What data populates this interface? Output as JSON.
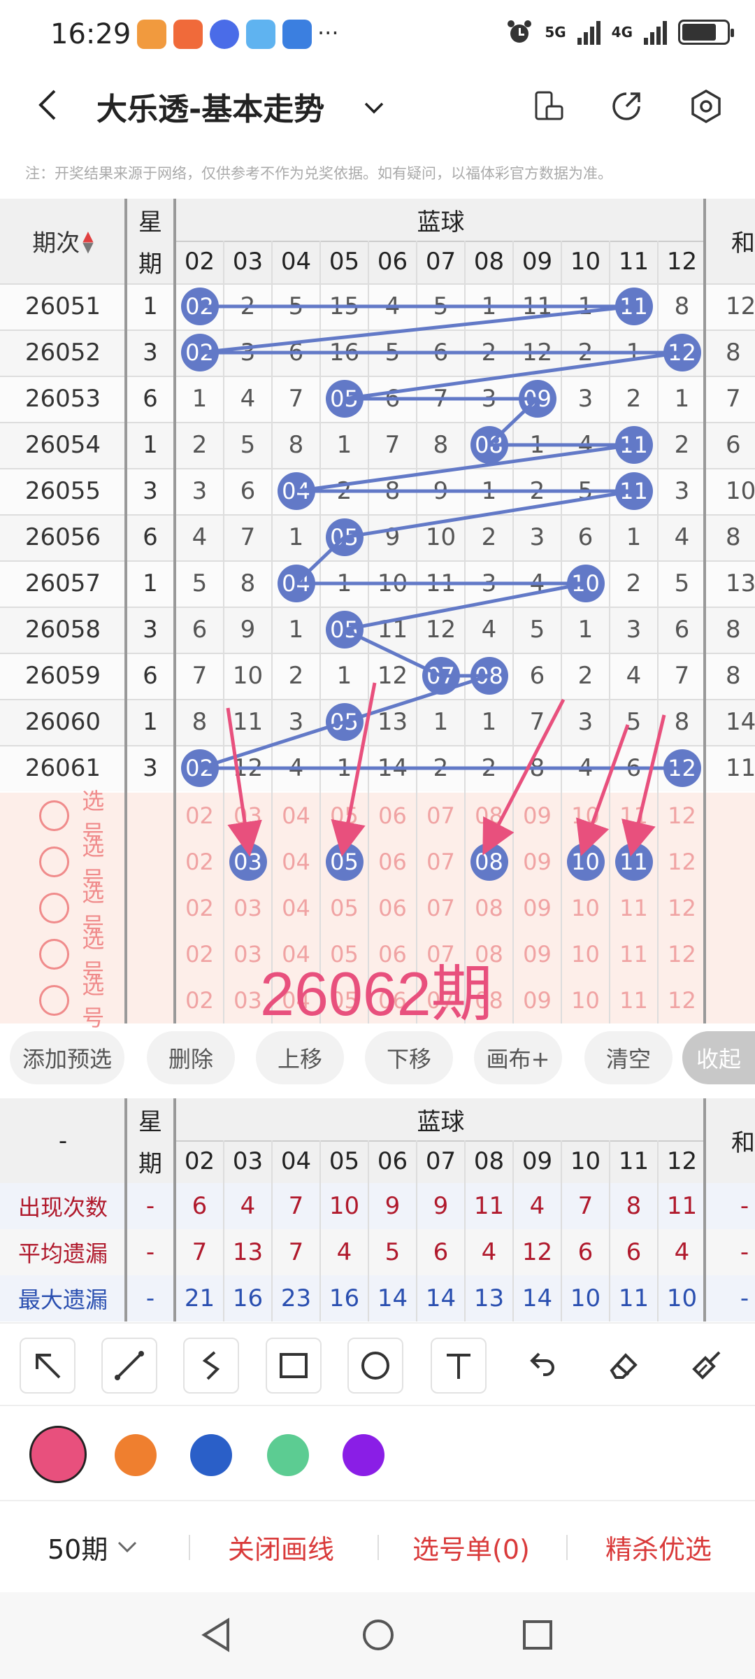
{
  "status": {
    "time": "16:29",
    "network1": "5G",
    "network2": "4G",
    "more": "···"
  },
  "header": {
    "title": "大乐透-基本走势"
  },
  "notice": "注：开奖结果来源于网络，仅供参考不作为兑奖依据。如有疑问，以福体彩官方数据为准。",
  "table": {
    "col_period": "期次",
    "col_week_1": "星",
    "col_week_2": "期",
    "group_label": "蓝球",
    "sum_label": "和",
    "numbers": [
      "02",
      "03",
      "04",
      "05",
      "06",
      "07",
      "08",
      "09",
      "10",
      "11",
      "12"
    ],
    "rows": [
      {
        "period": "26051",
        "week": "1",
        "cells": [
          "02",
          "2",
          "5",
          "15",
          "4",
          "5",
          "1",
          "11",
          "1",
          "11",
          "8"
        ],
        "hits": [
          0,
          9
        ],
        "sum": "12"
      },
      {
        "period": "26052",
        "week": "3",
        "cells": [
          "02",
          "3",
          "6",
          "16",
          "5",
          "6",
          "2",
          "12",
          "2",
          "1",
          "12"
        ],
        "hits": [
          0,
          10
        ],
        "sum": "8"
      },
      {
        "period": "26053",
        "week": "6",
        "cells": [
          "1",
          "4",
          "7",
          "05",
          "6",
          "7",
          "3",
          "09",
          "3",
          "2",
          "1"
        ],
        "hits": [
          3,
          7
        ],
        "sum": "7"
      },
      {
        "period": "26054",
        "week": "1",
        "cells": [
          "2",
          "5",
          "8",
          "1",
          "7",
          "8",
          "08",
          "1",
          "4",
          "11",
          "2"
        ],
        "hits": [
          6,
          9
        ],
        "sum": "6"
      },
      {
        "period": "26055",
        "week": "3",
        "cells": [
          "3",
          "6",
          "04",
          "2",
          "8",
          "9",
          "1",
          "2",
          "5",
          "11",
          "3"
        ],
        "hits": [
          2,
          9
        ],
        "sum": "10"
      },
      {
        "period": "26056",
        "week": "6",
        "cells": [
          "4",
          "7",
          "1",
          "05",
          "9",
          "10",
          "2",
          "3",
          "6",
          "1",
          "4"
        ],
        "hits": [
          3
        ],
        "sum": "8"
      },
      {
        "period": "26057",
        "week": "1",
        "cells": [
          "5",
          "8",
          "04",
          "1",
          "10",
          "11",
          "3",
          "4",
          "10",
          "2",
          "5"
        ],
        "hits": [
          2,
          8
        ],
        "sum": "13"
      },
      {
        "period": "26058",
        "week": "3",
        "cells": [
          "6",
          "9",
          "1",
          "05",
          "11",
          "12",
          "4",
          "5",
          "1",
          "3",
          "6"
        ],
        "hits": [
          3
        ],
        "sum": "8"
      },
      {
        "period": "26059",
        "week": "6",
        "cells": [
          "7",
          "10",
          "2",
          "1",
          "12",
          "07",
          "08",
          "6",
          "2",
          "4",
          "7"
        ],
        "hits": [
          5,
          6
        ],
        "sum": "8"
      },
      {
        "period": "26060",
        "week": "1",
        "cells": [
          "8",
          "11",
          "3",
          "05",
          "13",
          "1",
          "1",
          "7",
          "3",
          "5",
          "8"
        ],
        "hits": [
          3
        ],
        "sum": "14"
      },
      {
        "period": "26061",
        "week": "3",
        "cells": [
          "02",
          "12",
          "4",
          "1",
          "14",
          "2",
          "2",
          "8",
          "4",
          "6",
          "12"
        ],
        "hits": [
          0,
          10
        ],
        "sum": "11"
      }
    ],
    "pick_label": "选号",
    "pick_rows": [
      {
        "selected": []
      },
      {
        "selected": [
          1,
          3,
          6,
          8,
          9
        ]
      },
      {
        "selected": []
      },
      {
        "selected": []
      },
      {
        "selected": []
      }
    ],
    "next_period": "26062期"
  },
  "actions": [
    "添加预选",
    "删除",
    "上移",
    "下移",
    "画布+",
    "清空",
    "收起"
  ],
  "stats": {
    "dash": "-",
    "rows": [
      {
        "label": "出现次数",
        "color": "#b0192c",
        "week": "-",
        "values": [
          "6",
          "4",
          "7",
          "10",
          "9",
          "9",
          "11",
          "4",
          "7",
          "8",
          "11"
        ],
        "tail": "-"
      },
      {
        "label": "平均遗漏",
        "color": "#b0192c",
        "week": "-",
        "values": [
          "7",
          "13",
          "7",
          "4",
          "5",
          "6",
          "4",
          "12",
          "6",
          "6",
          "4"
        ],
        "tail": "-"
      },
      {
        "label": "最大遗漏",
        "color": "#2a4fb0",
        "week": "-",
        "values": [
          "21",
          "16",
          "23",
          "16",
          "14",
          "14",
          "13",
          "14",
          "10",
          "11",
          "10"
        ],
        "tail": "-"
      }
    ]
  },
  "palette": {
    "pink": "#e8507d",
    "orange": "#ef7f2f",
    "blue": "#2a5fc8",
    "green": "#5ccc92",
    "purple": "#8a1ee6",
    "ball": "#6279c7"
  },
  "bottom": {
    "periods": "50期",
    "close_lines": "关闭画线",
    "pick_list": "选号单(0)",
    "premium": "精杀优选"
  }
}
